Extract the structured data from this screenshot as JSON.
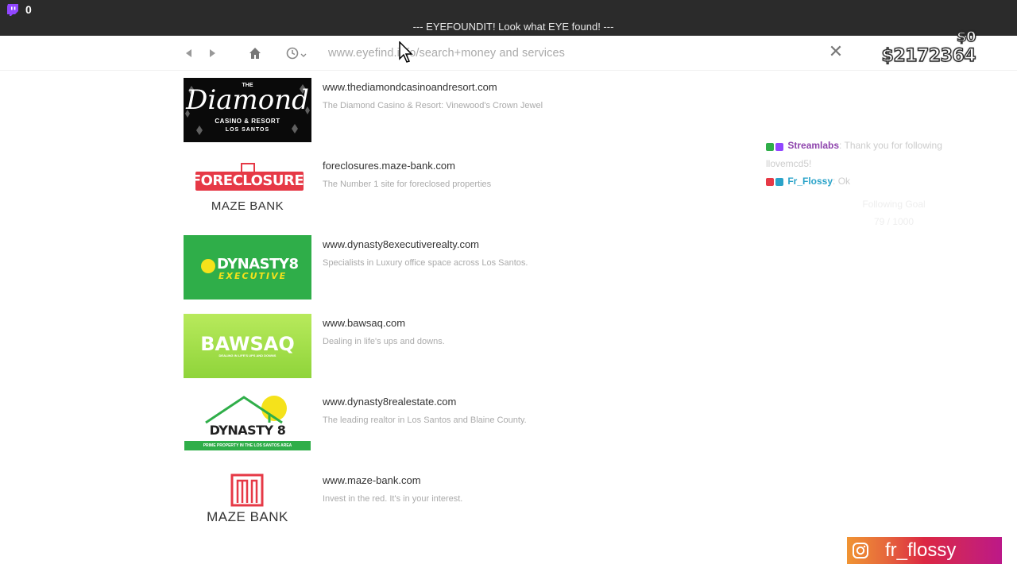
{
  "stream_overlay": {
    "viewer_count": "0",
    "colors": {
      "twitch_purple": "#9146ff"
    }
  },
  "window": {
    "title": "--- EYEFOUNDIT! Look what EYE found! ---"
  },
  "nav": {
    "url": "www.eyefind.info/search+money and services"
  },
  "hud": {
    "wallet": "$0",
    "bank": "$2172364"
  },
  "results": [
    {
      "url": "www.thediamondcasinoandresort.com",
      "desc": "The Diamond Casino & Resort: Vinewood's Crown Jewel",
      "logo": {
        "line1": "THE",
        "line2": "Diamond",
        "line3": "CASINO & RESORT",
        "line4": "LOS SANTOS"
      }
    },
    {
      "url": "foreclosures.maze-bank.com",
      "desc": "The Number 1 site for foreclosed properties",
      "logo": {
        "line1": "FORECLOSURE",
        "line2": "MAZE BANK"
      }
    },
    {
      "url": "www.dynasty8executiverealty.com",
      "desc": "Specialists in Luxury office space across Los Santos.",
      "logo": {
        "line1": "DYNASTY8",
        "line2": "EXECUTIVE"
      }
    },
    {
      "url": "www.bawsaq.com",
      "desc": "Dealing in life's ups and downs.",
      "logo": {
        "line1": "BAWSAQ",
        "line2": "DEALING IN LIFE'S UPS AND DOWNS"
      }
    },
    {
      "url": "www.dynasty8realestate.com",
      "desc": "The leading realtor in Los Santos and Blaine County.",
      "logo": {
        "line1": "DYNASTY 8",
        "line2": "PRIME PROPERTY IN THE LOS SANTOS AREA"
      }
    },
    {
      "url": "www.maze-bank.com",
      "desc": "Invest in the red. It's in your interest.",
      "logo": {
        "line1": "MAZE BANK"
      }
    }
  ],
  "chat": [
    {
      "user": "Streamlabs",
      "message": ": Thank you for following llovemcd5!",
      "user_color": "#8e44ad"
    },
    {
      "user": "Fr_Flossy",
      "message": ": Ok",
      "user_color": "#2aa3c9"
    }
  ],
  "chat_faded": {
    "line1": "Following Goal",
    "line2": "79 / 1000"
  },
  "social": {
    "instagram_handle": "fr_flossy",
    "icon": "instagram-icon"
  }
}
